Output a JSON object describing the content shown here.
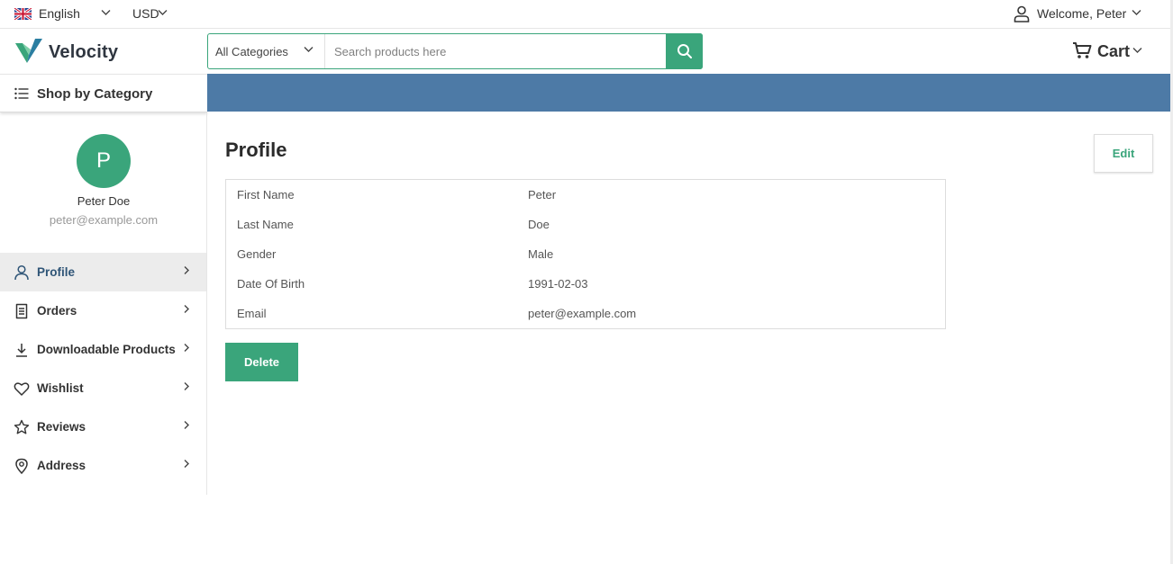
{
  "topbar": {
    "language": "English",
    "currency": "USD",
    "welcome": "Welcome, Peter",
    "flag_icon": "uk-flag-icon",
    "user_icon": "user-icon"
  },
  "header": {
    "brand": "Velocity",
    "category_select": "All Categories",
    "search_placeholder": "Search products here",
    "cart_label": "Cart"
  },
  "category_bar": {
    "label": "Shop by Category",
    "bar_color": "#4d7aa6"
  },
  "sidebar": {
    "avatar_initial": "P",
    "user_name": "Peter Doe",
    "user_email": "peter@example.com",
    "menu": [
      {
        "label": "Profile",
        "icon": "user-icon",
        "active": true
      },
      {
        "label": "Orders",
        "icon": "receipt-icon",
        "active": false
      },
      {
        "label": "Downloadable Products",
        "icon": "download-icon",
        "active": false
      },
      {
        "label": "Wishlist",
        "icon": "heart-icon",
        "active": false
      },
      {
        "label": "Reviews",
        "icon": "star-icon",
        "active": false
      },
      {
        "label": "Address",
        "icon": "location-pin-icon",
        "active": false
      }
    ]
  },
  "main": {
    "title": "Profile",
    "edit_label": "Edit",
    "delete_label": "Delete",
    "fields": [
      {
        "label": "First Name",
        "value": "Peter"
      },
      {
        "label": "Last Name",
        "value": "Doe"
      },
      {
        "label": "Gender",
        "value": "Male"
      },
      {
        "label": "Date Of Birth",
        "value": "1991-02-03"
      },
      {
        "label": "Email",
        "value": "peter@example.com"
      }
    ]
  },
  "colors": {
    "accent": "#3aa57b",
    "active_text": "#2f5577"
  }
}
